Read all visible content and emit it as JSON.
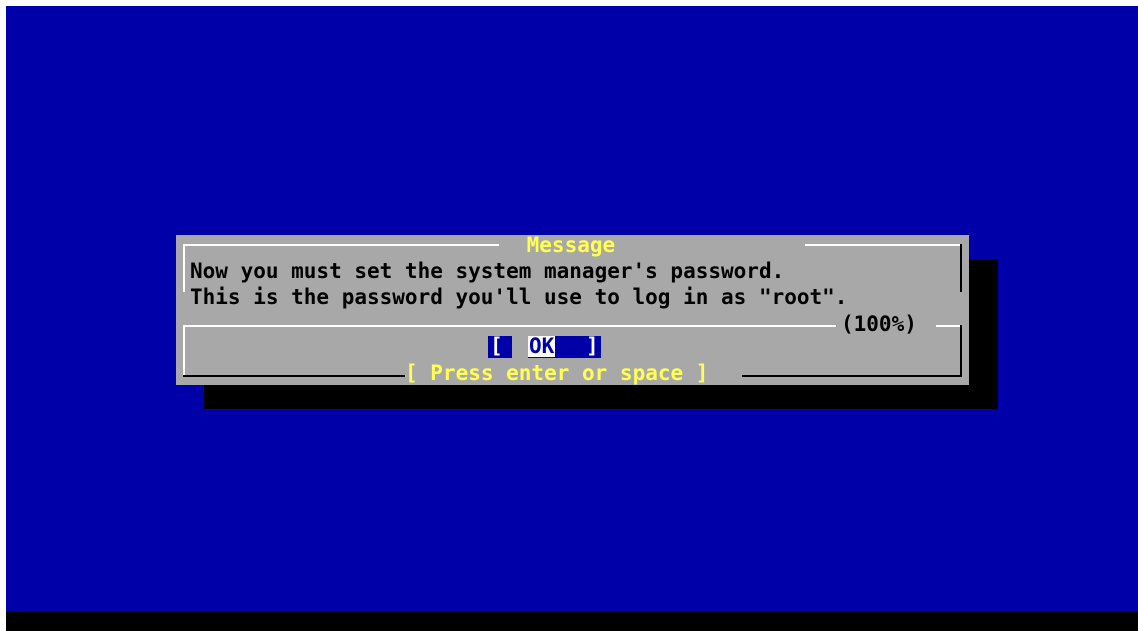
{
  "screen": {
    "background_color": "#0000a8",
    "bottom_bar_color": "#000000"
  },
  "dialog": {
    "title": " Message ",
    "message_lines": [
      "Now you must set the system manager's password.",
      "This is the password you'll use to log in as \"root\"."
    ],
    "progress": "(100%)",
    "ok_button": {
      "left_bracket": "[",
      "label": "OK",
      "right_bracket": "]"
    },
    "hint": "[ Press enter or space ]",
    "colors": {
      "dialog_background": "#a8a8a8",
      "title_text": "#ffff54",
      "hint_text": "#ffff54",
      "button_background": "#0000a8",
      "shadow": "#000000"
    }
  }
}
